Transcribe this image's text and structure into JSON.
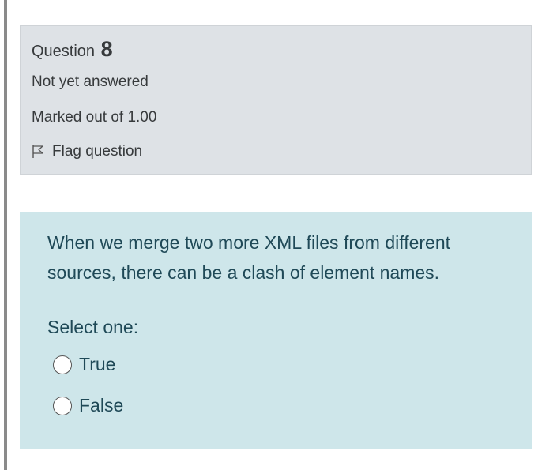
{
  "info": {
    "question_word": "Question",
    "question_number": "8",
    "state": "Not yet answered",
    "grade": "Marked out of 1.00",
    "flag_label": "Flag question",
    "flag_icon": "flag-icon"
  },
  "question": {
    "text": "When we merge two more XML files from different sources, there can be a clash of element names.",
    "prompt": "Select one:",
    "options": [
      {
        "label": "True",
        "selected": false
      },
      {
        "label": "False",
        "selected": false
      }
    ]
  },
  "colors": {
    "info_background": "#dee2e6",
    "content_background": "#cee6ea",
    "question_text": "#1f4957"
  }
}
